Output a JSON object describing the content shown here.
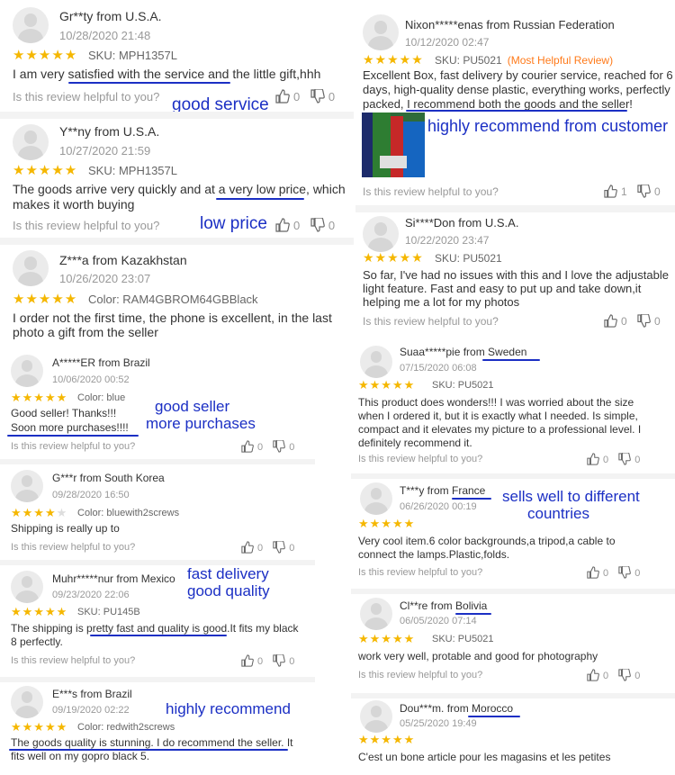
{
  "helpful_question": "Is this review helpful to you?",
  "r1": {
    "name": "Gr**ty from  U.S.A.",
    "date": "10/28/2020 21:48",
    "sku": "SKU: MPH1357L",
    "text": "I am very satisfied with the service and the little gift,hhh",
    "up": "0",
    "down": "0",
    "note": "good service"
  },
  "r2": {
    "name": "Y**ny from  U.S.A.",
    "date": "10/27/2020 21:59",
    "sku": "SKU: MPH1357L",
    "text": "The goods arrive very quickly and at a very low price, which makes it worth buying",
    "up": "0",
    "down": "0",
    "note": "low price"
  },
  "r3": {
    "name": "Z***a from Kazakhstan",
    "date": "10/26/2020 23:07",
    "sku": "Color: RAM4GBROM64GBBlack",
    "text": "I order not the first time, the phone is excellent, in the last photo a gift from the seller"
  },
  "r4": {
    "name": "Nixon*****enas from  Russian Federation",
    "date": "10/12/2020 02:47",
    "sku": "SKU: PU5021",
    "tag": "(Most Helpful Review)",
    "text": "Excellent Box, fast delivery by courier service, reached for 6 days, high-quality dense plastic, everything works, perfectly packed, I recommend both the goods and the seller!",
    "up": "1",
    "down": "0",
    "note": "highly recommend from customer"
  },
  "r5": {
    "name": "Si****Don from  U.S.A.",
    "date": "10/22/2020 23:47",
    "sku": "SKU: PU5021",
    "text": "So far, I've had no issues with this and I love the adjustable light feature. Fast and easy to put up and take down,it helping me a lot for my photos",
    "up": "0",
    "down": "0"
  },
  "r6": {
    "name": "A*****ER from Brazil",
    "date": "10/06/2020 00:52",
    "sku": "Color: blue",
    "text_l1": "Good seller! Thanks!!!",
    "text_l2": "Soon more purchases!!!!",
    "up": "0",
    "down": "0",
    "note_l1": "good seller",
    "note_l2": "more purchases"
  },
  "r7": {
    "name": "G***r from South Korea",
    "date": "09/28/2020 16:50",
    "sku": "Color: bluewith2screws",
    "text": "Shipping is really up to",
    "up": "0",
    "down": "0"
  },
  "r8": {
    "name": "Muhr*****nur from  Mexico",
    "date": "09/23/2020 22:06",
    "sku": "SKU: PU145B",
    "text": "The shipping is pretty fast and quality is good.It fits my black 8 perfectly.",
    "up": "0",
    "down": "0",
    "note_l1": "fast delivery",
    "note_l2": "good quality"
  },
  "r9": {
    "name": "E***s from Brazil",
    "date": "09/19/2020 02:22",
    "sku": "Color: redwith2screws",
    "text": "The goods quality is stunning. I do recommend the seller. It fits well on my gopro black 5.",
    "note": "highly recommend"
  },
  "r10": {
    "name": "Suaa*****pie from  Sweden",
    "date": "07/15/2020 06:08",
    "sku": "SKU: PU5021",
    "text": "This product does wonders!!! I was worried about the size when I ordered it, but it is exactly what I needed. Is simple, compact and it elevates my picture to a professional level. I definitely recommend it.",
    "up": "0",
    "down": "0"
  },
  "r11": {
    "name": "T***y from France",
    "date": "06/26/2020 00:19",
    "text": "Very cool item.6 color backgrounds,a tripod,a cable to connect the lamps.Plastic,folds.",
    "up": "0",
    "down": "0",
    "note_l1": "sells well to different",
    "note_l2": "countries"
  },
  "r12": {
    "name": "Cl**re from  Bolivia",
    "date": "06/05/2020 07:14",
    "sku": "SKU: PU5021",
    "text": "work very well, protable and good for photography",
    "up": "0",
    "down": "0"
  },
  "r13": {
    "name": "Dou***m. from Morocco",
    "date": "05/25/2020 19:49",
    "text": "C'est un bone article pour les magasins et les petites"
  },
  "colors": {
    "star": "#f5b700",
    "annotation": "#1b2fc4",
    "tag": "#ff7a1a"
  }
}
